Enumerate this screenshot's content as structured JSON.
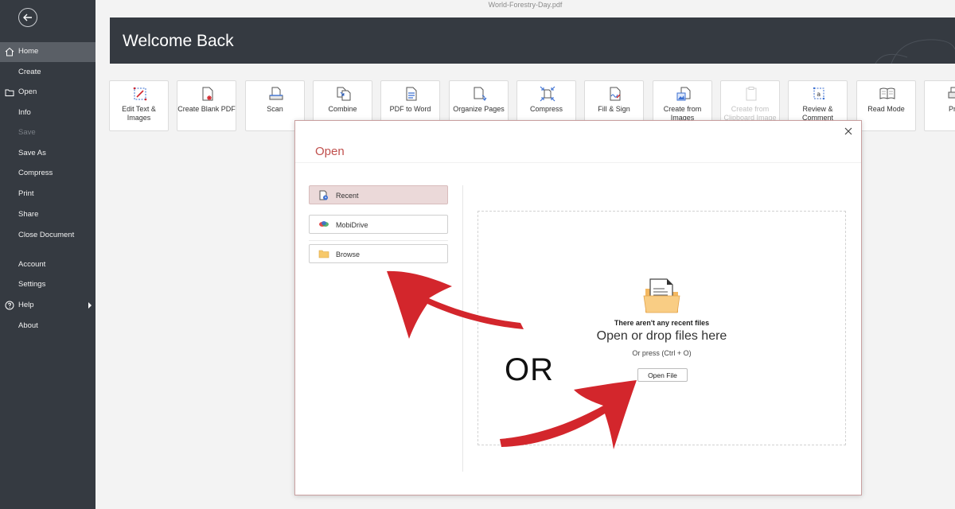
{
  "window": {
    "filename": "World-Forestry-Day.pdf"
  },
  "sidebar": {
    "items": [
      {
        "label": "Home",
        "icon": "home-icon",
        "state": "active"
      },
      {
        "label": "Create"
      },
      {
        "label": "Open",
        "icon": "folder-icon"
      },
      {
        "label": "Info"
      },
      {
        "label": "Save",
        "state": "disabled"
      },
      {
        "label": "Save As"
      },
      {
        "label": "Compress"
      },
      {
        "label": "Print"
      },
      {
        "label": "Share"
      },
      {
        "label": "Close Document"
      },
      {
        "label": "Account"
      },
      {
        "label": "Settings"
      },
      {
        "label": "Help",
        "icon": "help-icon",
        "submenu": true
      },
      {
        "label": "About"
      }
    ]
  },
  "banner": {
    "title": "Welcome Back"
  },
  "tools": [
    {
      "label": "Edit Text & Images",
      "icon": "edit-text-icon"
    },
    {
      "label": "Create Blank PDF",
      "icon": "create-blank-icon"
    },
    {
      "label": "Scan",
      "icon": "scan-icon"
    },
    {
      "label": "Combine",
      "icon": "combine-icon"
    },
    {
      "label": "PDF to Word",
      "icon": "pdf-to-word-icon"
    },
    {
      "label": "Organize Pages",
      "icon": "organize-pages-icon"
    },
    {
      "label": "Compress",
      "icon": "compress-icon"
    },
    {
      "label": "Fill & Sign",
      "icon": "fill-sign-icon"
    },
    {
      "label": "Create from Images",
      "icon": "create-images-icon"
    },
    {
      "label": "Create from Clipboard Image",
      "icon": "clipboard-icon",
      "state": "disabled"
    },
    {
      "label": "Review & Comment",
      "icon": "review-icon"
    },
    {
      "label": "Read Mode",
      "icon": "read-mode-icon"
    },
    {
      "label": "Pri",
      "icon": "print-icon"
    }
  ],
  "open_dialog": {
    "title": "Open",
    "locations": [
      {
        "label": "Recent",
        "icon": "recent-icon",
        "state": "selected"
      },
      {
        "label": "MobiDrive",
        "icon": "mobidrive-icon"
      },
      {
        "label": "Browse",
        "icon": "browse-folder-icon"
      }
    ],
    "empty_title": "There aren't any recent files",
    "drop_text": "Open or drop files here",
    "shortcut_text": "Or press (Ctrl + O)",
    "open_button": "Open File"
  },
  "annotation": {
    "or_text": "OR",
    "arrow_color": "#d3262c"
  },
  "colors": {
    "sidebar_bg": "#353a41",
    "banner_bg": "#353a41",
    "accent": "#c0504d",
    "selected_bg": "#ebd9d9"
  }
}
